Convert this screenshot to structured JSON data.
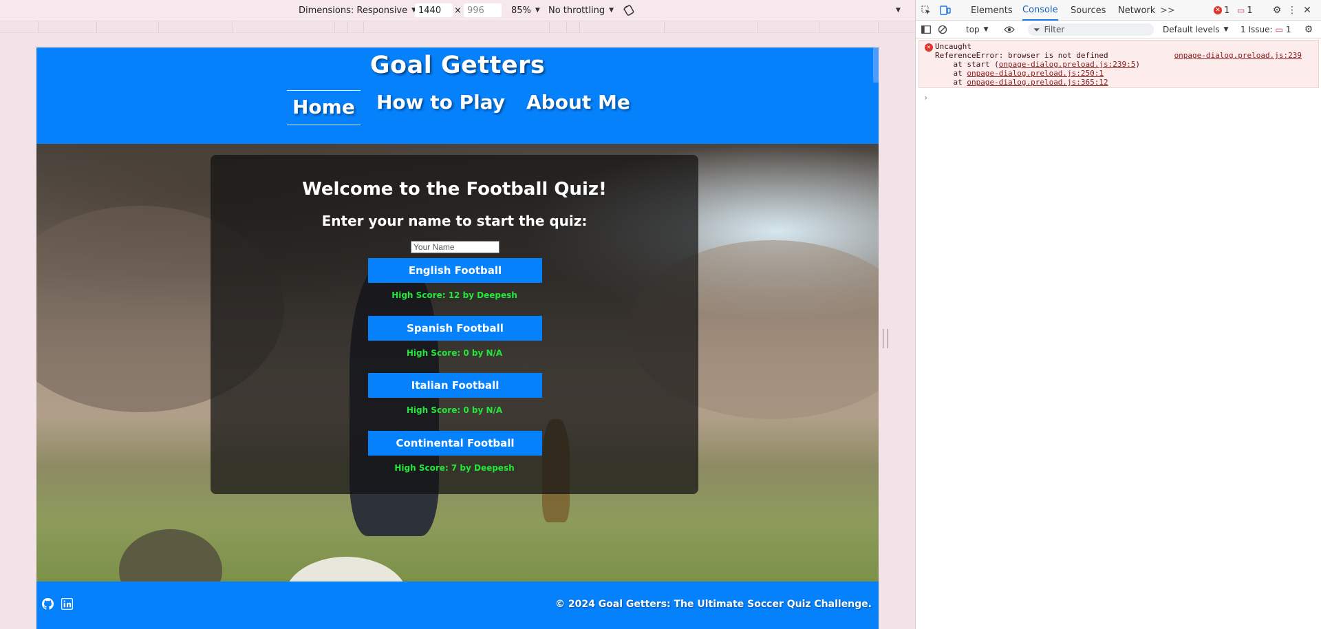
{
  "device_toolbar": {
    "dimensions_label": "Dimensions: Responsive",
    "width": "1440",
    "times": "×",
    "height": "996",
    "zoom": "85%",
    "throttling": "No throttling"
  },
  "site": {
    "title": "Goal Getters",
    "nav": [
      {
        "label": "Home",
        "active": true
      },
      {
        "label": "How to Play",
        "active": false
      },
      {
        "label": "About Me",
        "active": false
      }
    ]
  },
  "quiz": {
    "title": "Welcome to the Football Quiz!",
    "subtitle": "Enter your name to start the quiz:",
    "name_placeholder": "Your Name",
    "categories": [
      {
        "label": "English Football",
        "high_score": "High Score: 12 by Deepesh"
      },
      {
        "label": "Spanish Football",
        "high_score": "High Score: 0 by N/A"
      },
      {
        "label": "Italian Football",
        "high_score": "High Score: 0 by N/A"
      },
      {
        "label": "Continental Football",
        "high_score": "High Score: 7 by Deepesh"
      }
    ]
  },
  "footer": {
    "icons": [
      "github-icon",
      "linkedin-icon"
    ],
    "copyright": "© 2024 Goal Getters: The Ultimate Soccer Quiz Challenge."
  },
  "devtools": {
    "tabs": [
      "Elements",
      "Console",
      "Sources",
      "Network"
    ],
    "active_tab": "Console",
    "more": ">>",
    "error_count": "1",
    "message_count": "1",
    "context": "top",
    "filter_placeholder": "Filter",
    "levels": "Default levels",
    "issues_label": "1 Issue:",
    "issues_count": "1",
    "error": {
      "title": "Uncaught",
      "message": "ReferenceError: browser is not defined",
      "source": "onpage-dialog.preload.js:239",
      "stack": [
        {
          "prefix": "    at start (",
          "link": "onpage-dialog.preload.js:239:5",
          "suffix": ")"
        },
        {
          "prefix": "    at ",
          "link": "onpage-dialog.preload.js:250:1",
          "suffix": ""
        },
        {
          "prefix": "    at ",
          "link": "onpage-dialog.preload.js:365:12",
          "suffix": ""
        }
      ]
    },
    "prompt": "›"
  },
  "colors": {
    "brand_blue": "#0681fc",
    "high_score_green": "#22e83a",
    "devtools_active": "#1a73e8",
    "error_red": "#dc362e"
  }
}
